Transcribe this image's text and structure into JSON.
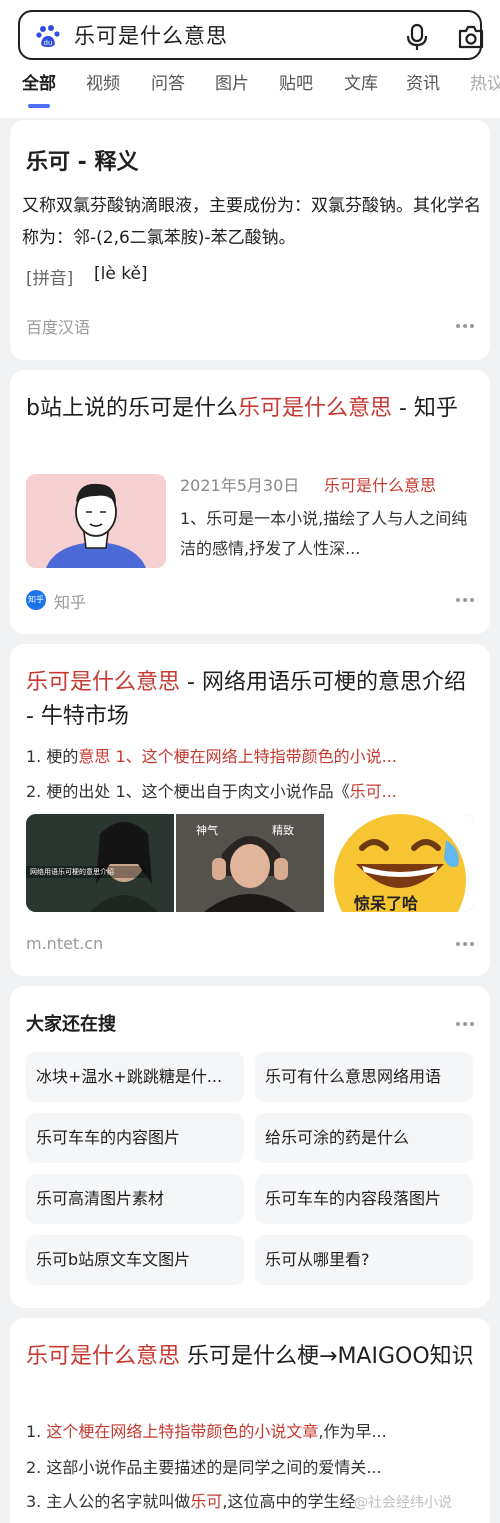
{
  "search": {
    "query": "乐可是什么意思"
  },
  "tabs": [
    "全部",
    "视频",
    "问答",
    "图片",
    "贴吧",
    "文库",
    "资讯",
    "热议"
  ],
  "card1": {
    "title": "乐可 - 释义",
    "desc": "又称双氯芬酸钠滴眼液，主要成份为：双氯芬酸钠。其化学名称为：邻-(2,6二氯苯胺)-苯乙酸钠。",
    "pinyin_label": "[拼音]",
    "pinyin_value": "[lè kě]",
    "source": "百度汉语"
  },
  "card2": {
    "title_plain": "b站上说的乐可是什么",
    "title_highlight": "乐可是什么意思",
    "title_tail": " - 知乎",
    "date": "2021年5月30日",
    "date_tag": "乐可是什么意思",
    "snippet": "1、乐可是一本小说,描绘了人与人之间纯洁的感情,抒发了人性深...",
    "badge": "知乎",
    "source": "知乎"
  },
  "card3": {
    "title_highlight": "乐可是什么意思",
    "title_tail": " - 网络用语乐可梗的意思介绍 - 牛特市场",
    "line1_a": "1. 梗的",
    "line1_b": "意思 1、这个梗在网络上特指带颜色的小说...",
    "line2_a": "2. 梗的出处 1、这个梗出自于肉文小说作品《",
    "line2_b": "乐可...",
    "img1_caption": "网络用语乐可梗的意思介绍",
    "img2_caption_a": "神气",
    "img2_caption_b": "精致",
    "img3_caption": "惊呆了哈",
    "source": "m.ntet.cn"
  },
  "card4": {
    "title": "大家还在搜",
    "chips": [
      "冰块+温水+跳跳糖是什...",
      "乐可有什么意思网络用语",
      "乐可车车的内容图片",
      "给乐可涂的药是什么",
      "乐可高清图片素材",
      "乐可车车的内容段落图片",
      "乐可b站原文车文图片",
      "乐可从哪里看?"
    ]
  },
  "card5": {
    "title_highlight": "乐可是什么意思",
    "title_tail": " 乐可是什么梗→MAIGOO知识",
    "line1_a": "1. ",
    "line1_b": "这个梗在网络上特指带颜色的小说文章",
    "line1_c": ",作为早...",
    "line2": "2. 这部小说作品主要描述的是同学之间的爱情关...",
    "line3_a": "3. 主人公的名字就叫做",
    "line3_b": "乐可",
    "line3_c": ",这位高中的学生经",
    "watermark": "@社会经纬小说"
  },
  "colors": {
    "accent": "#4e6ef2",
    "highlight": "#c63a32"
  }
}
